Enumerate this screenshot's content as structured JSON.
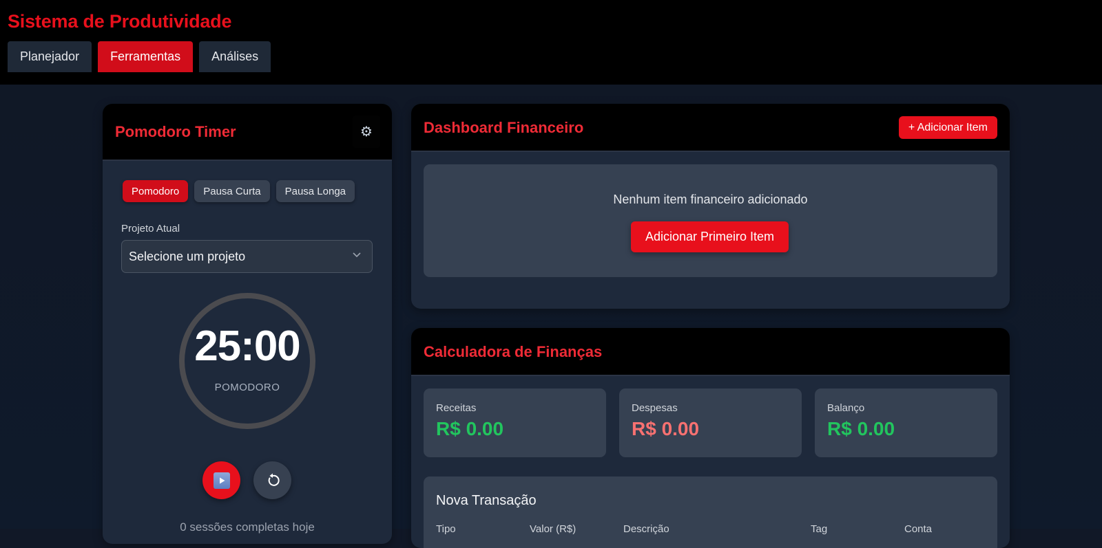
{
  "app": {
    "title": "Sistema de Produtividade",
    "tabs": [
      {
        "label": "Planejador",
        "active": false
      },
      {
        "label": "Ferramentas",
        "active": true
      },
      {
        "label": "Análises",
        "active": false
      }
    ]
  },
  "colors": {
    "accent": "#e8101c",
    "income": "#22c55e",
    "expense": "#f87171"
  },
  "pomodoro": {
    "title": "Pomodoro Timer",
    "settings_icon": "gear-icon",
    "modes": [
      "Pomodoro",
      "Pausa Curta",
      "Pausa Longa"
    ],
    "active_mode": "Pomodoro",
    "project_label": "Projeto Atual",
    "project_selected": "Selecione um projeto",
    "time": "25:00",
    "mode_label": "POMODORO",
    "play_icon": "play-icon",
    "reset_icon": "reset-icon",
    "sessions_text": "0 sessões completas hoje"
  },
  "dashboard": {
    "title": "Dashboard Financeiro",
    "add_label": "+ Adicionar Item",
    "empty_text": "Nenhum item financeiro adicionado",
    "first_item_label": "Adicionar Primeiro Item"
  },
  "calculator": {
    "title": "Calculadora de Finanças",
    "stats": [
      {
        "label": "Receitas",
        "value": "R$ 0.00"
      },
      {
        "label": "Despesas",
        "value": "R$ 0.00"
      },
      {
        "label": "Balanço",
        "value": "R$ 0.00"
      }
    ],
    "new_tx": {
      "title": "Nova Transação",
      "columns": [
        "Tipo",
        "Valor (R$)",
        "Descrição",
        "Tag",
        "Conta"
      ]
    }
  }
}
